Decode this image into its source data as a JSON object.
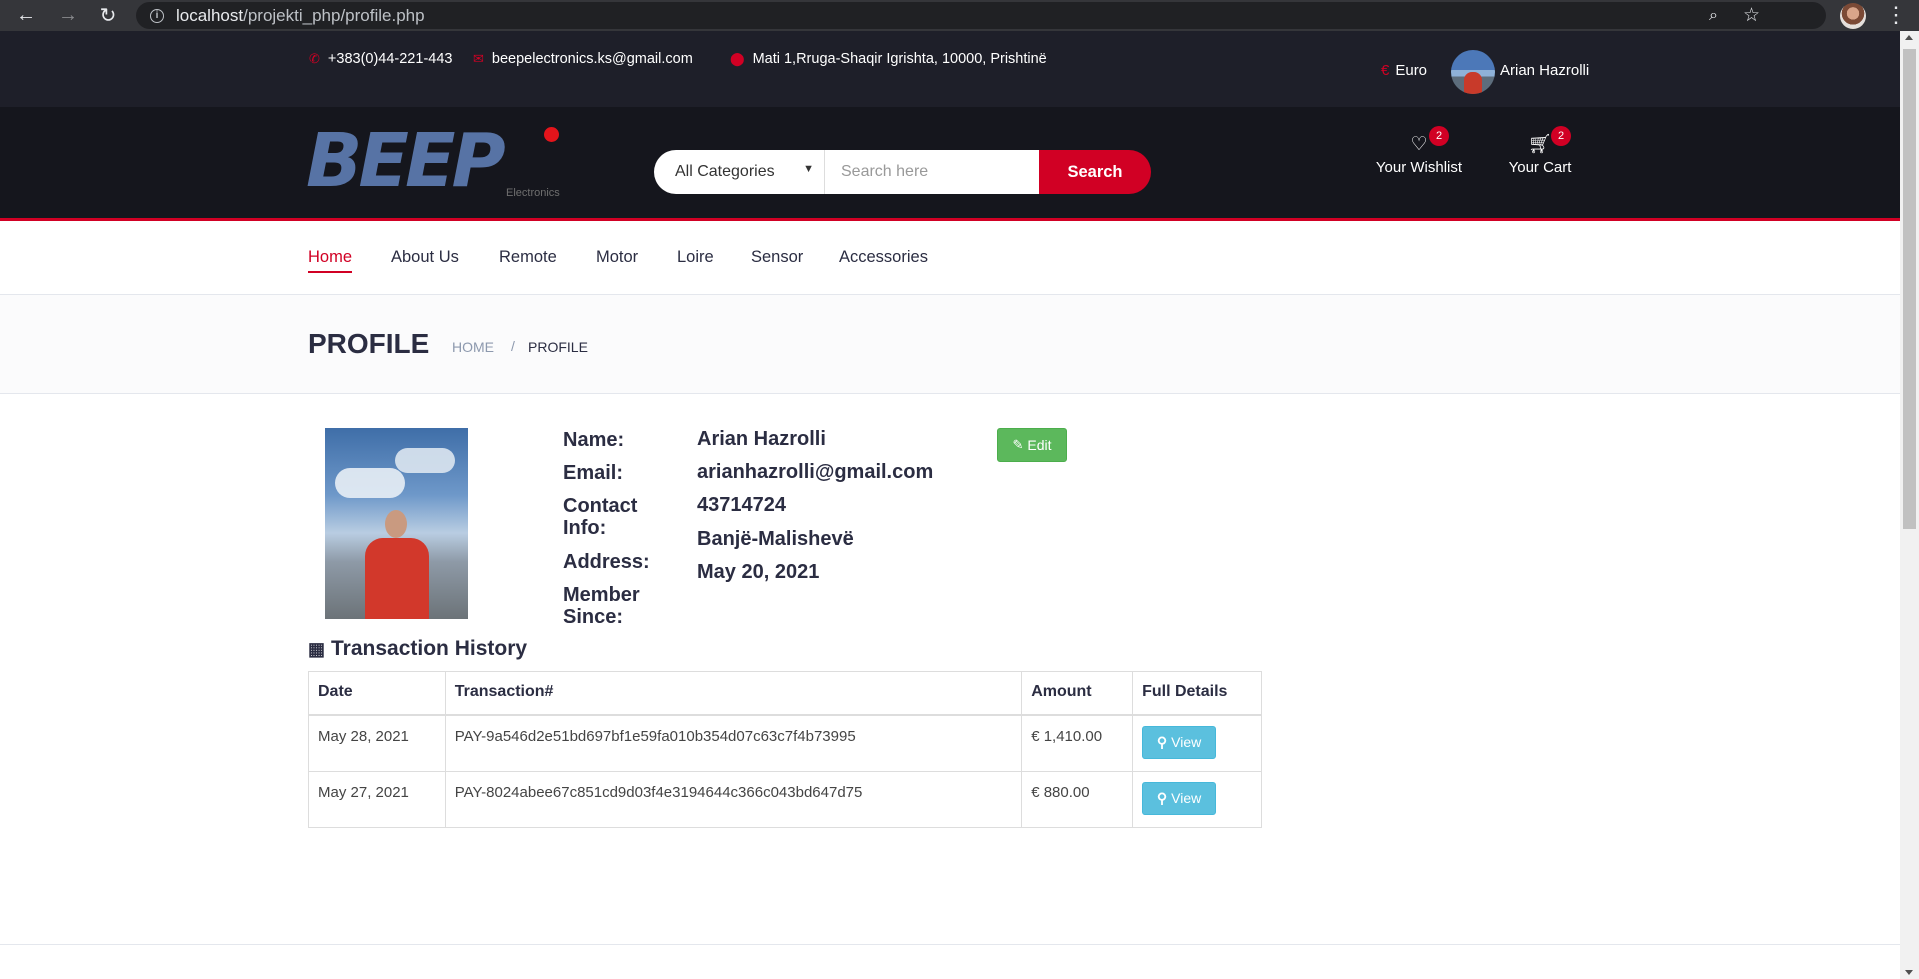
{
  "browser": {
    "url_host": "localhost",
    "url_path": "/projekti_php/profile.php"
  },
  "topbar": {
    "phone": "+383(0)44-221-443",
    "email": "beepelectronics.ks@gmail.com",
    "address": "Mati 1,Rruga-Shaqir Igrishta, 10000, Prishtinë",
    "currency_symbol": "€",
    "currency": "Euro",
    "user_name": "Arian Hazrolli"
  },
  "header": {
    "logo_text": "BEEP",
    "logo_sub": "Electronics",
    "category_select": "All Categories",
    "search_placeholder": "Search here",
    "search_button": "Search",
    "wishlist_label": "Your Wishlist",
    "wishlist_count": "2",
    "cart_label": "Your Cart",
    "cart_count": "2"
  },
  "nav": [
    "Home",
    "About Us",
    "Remote",
    "Motor",
    "Loire",
    "Sensor",
    "Accessories"
  ],
  "breadcrumb": {
    "title": "PROFILE",
    "home": "HOME",
    "separator": "/",
    "current": "PROFILE"
  },
  "profile": {
    "name_label": "Name:",
    "email_label": "Email:",
    "contact_label": "Contact Info:",
    "address_label": "Address:",
    "member_label": "Member Since:",
    "name": "Arian Hazrolli",
    "email": "arianhazrolli@gmail.com",
    "contact": "43714724",
    "address": "Banjë-Malishevë",
    "member_since": "May 20, 2021",
    "edit_button": "Edit"
  },
  "transactions": {
    "title": "Transaction History",
    "headers": [
      "Date",
      "Transaction#",
      "Amount",
      "Full Details"
    ],
    "rows": [
      {
        "date": "May 28, 2021",
        "id": "PAY-9a546d2e51bd697bf1e59fa010b354d07c63c7f4b73995",
        "amount": "€ 1,410.00",
        "action": "View"
      },
      {
        "date": "May 27, 2021",
        "id": "PAY-8024abee67c851cd9d03f4e3194644c366c043bd647d75",
        "amount": "€ 880.00",
        "action": "View"
      }
    ]
  },
  "colors": {
    "accent": "#d10024",
    "topbar_bg": "#1e1f29",
    "header_bg": "#15161d",
    "edit_green": "#5cb85c",
    "view_blue": "#5bc0de"
  },
  "icons": {
    "phone": "phone-icon",
    "email": "envelope-icon",
    "address": "map-marker-icon",
    "currency": "euro-icon",
    "wishlist": "heart-icon",
    "cart": "cart-icon",
    "edit": "pencil-icon",
    "calendar": "calendar-icon",
    "view": "search-icon"
  }
}
